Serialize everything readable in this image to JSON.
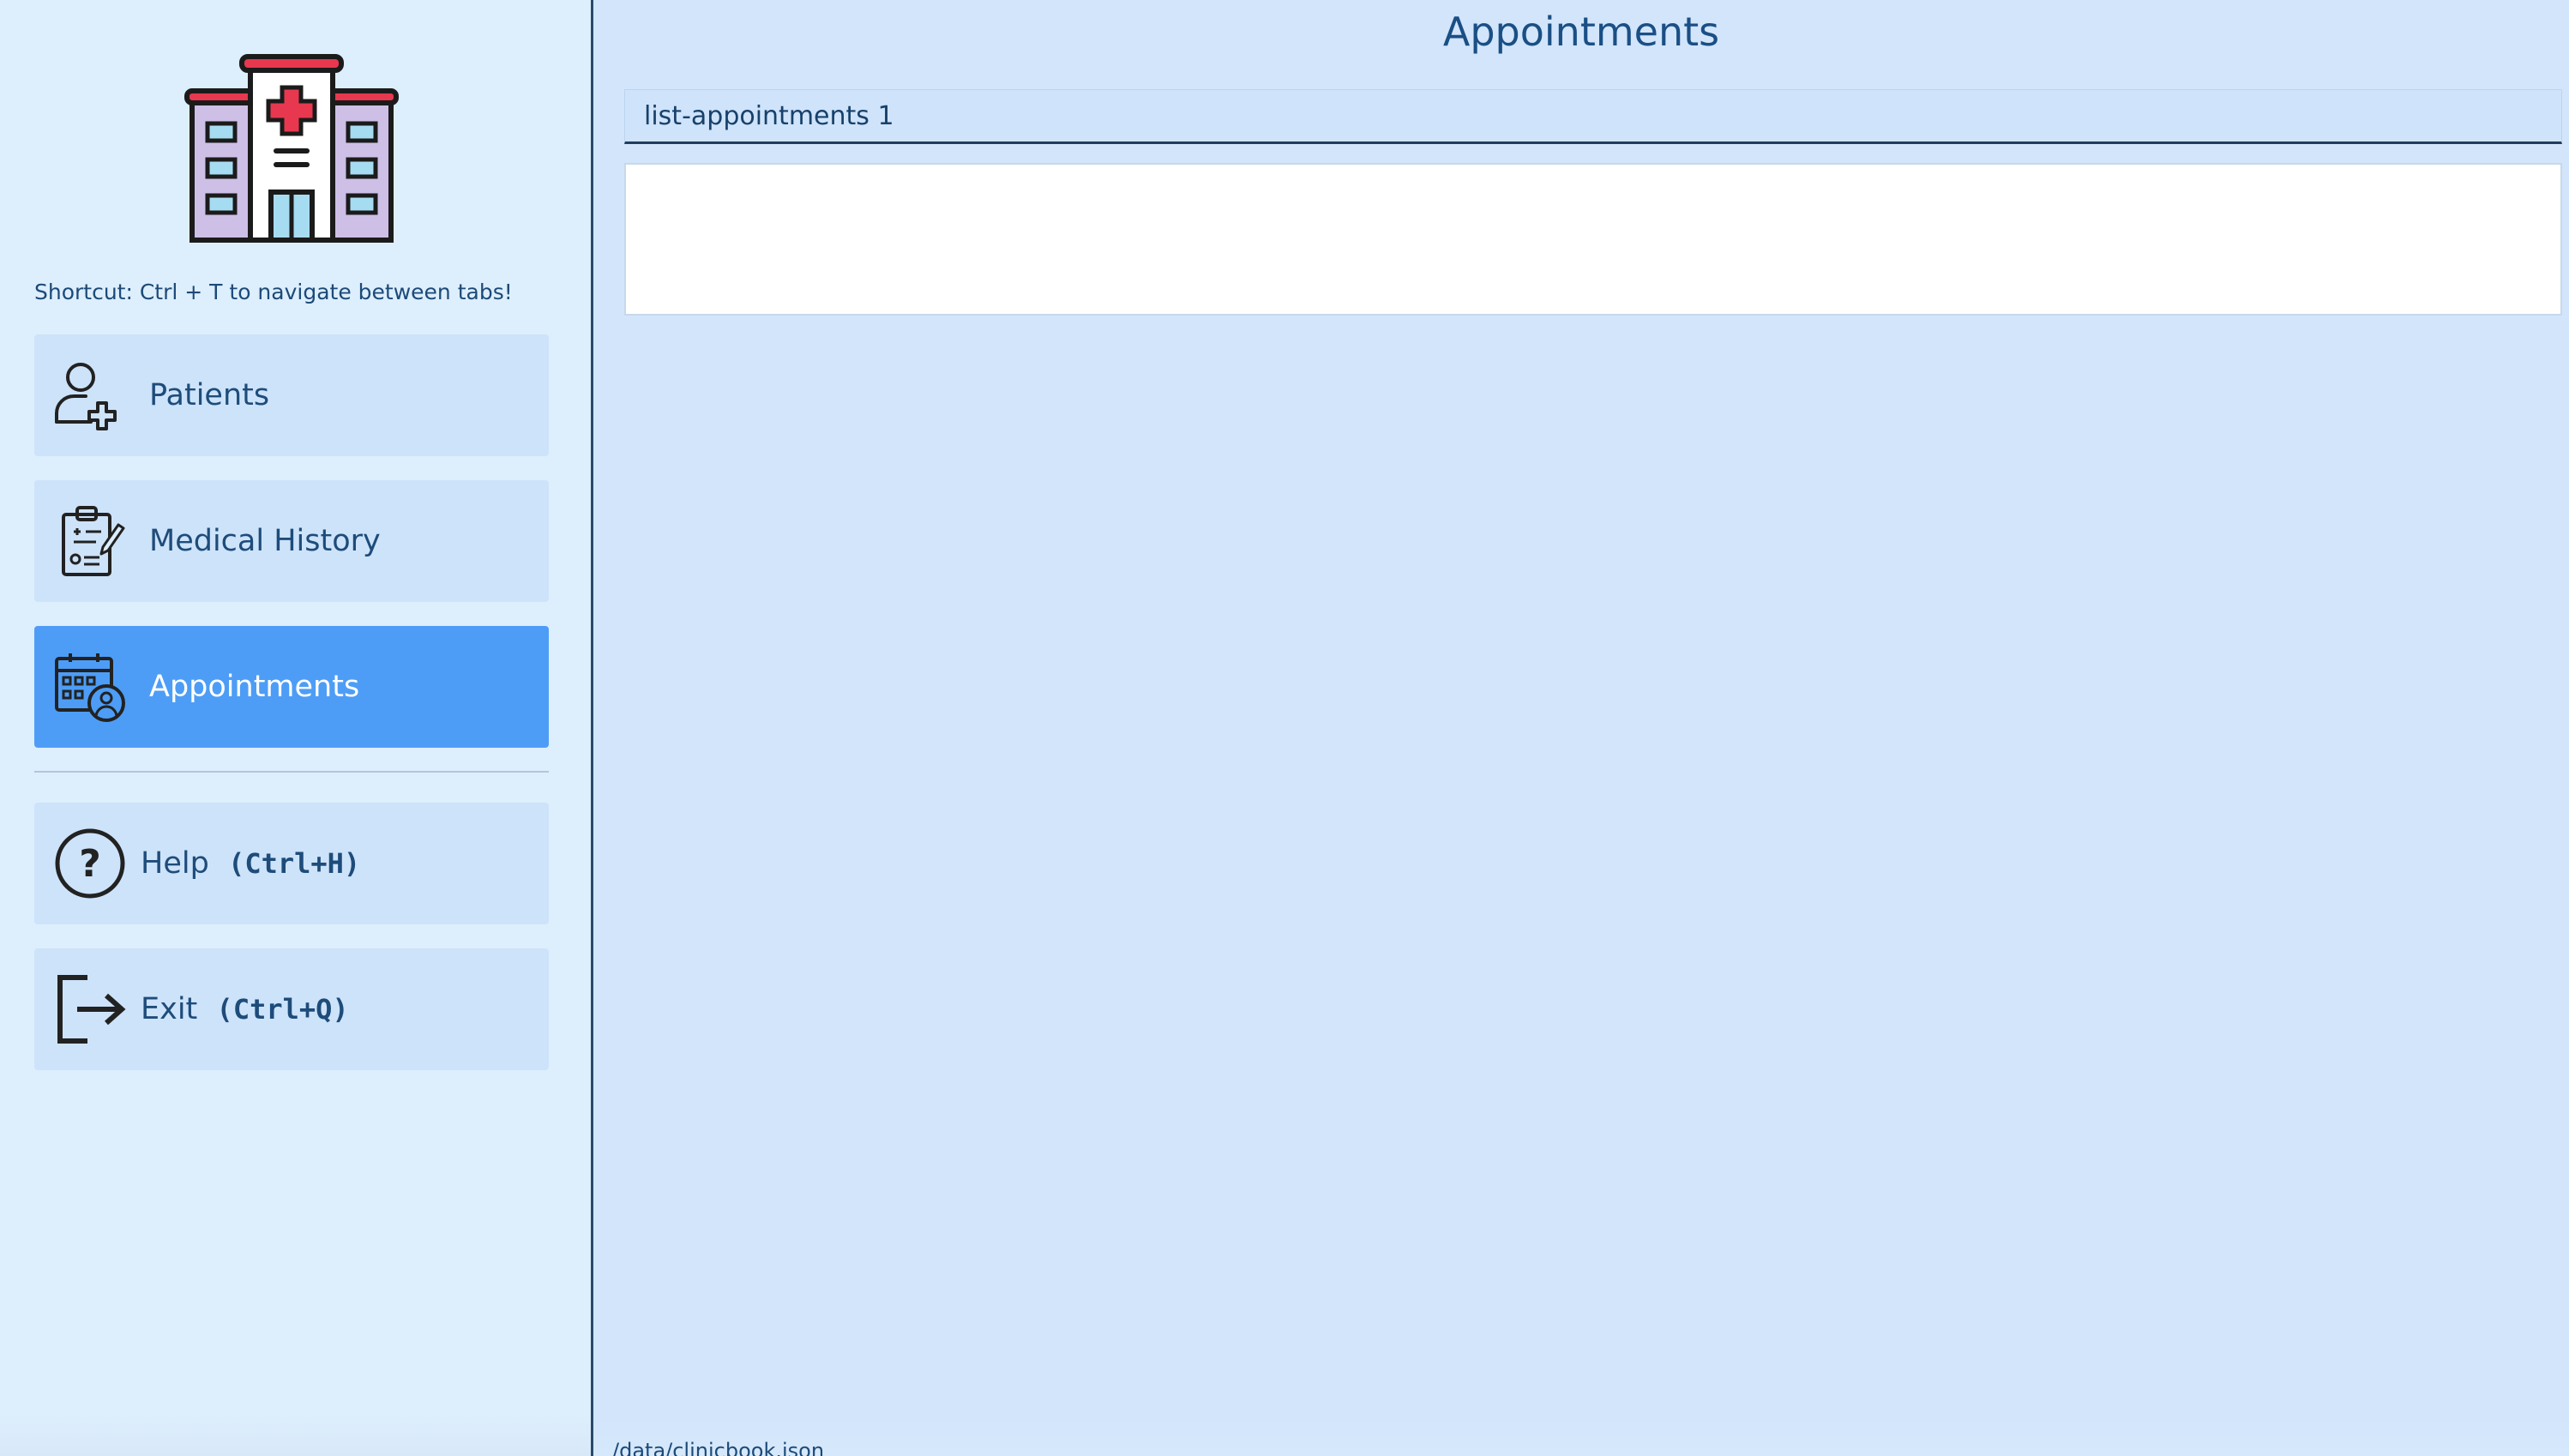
{
  "sidebar": {
    "logo_icon": "hospital-icon",
    "shortcut_text": "Shortcut: Ctrl + T to navigate between tabs!",
    "nav": [
      {
        "label": "Patients",
        "icon": "add-user-icon",
        "active": false
      },
      {
        "label": "Medical History",
        "icon": "clipboard-icon",
        "active": false
      },
      {
        "label": "Appointments",
        "icon": "calendar-doctor-icon",
        "active": true
      }
    ],
    "help": {
      "label": "Help",
      "shortcut": "(Ctrl+H)",
      "icon": "question-circle-icon"
    },
    "exit": {
      "label": "Exit",
      "shortcut": "(Ctrl+Q)",
      "icon": "exit-icon"
    }
  },
  "main": {
    "title": "Appointments",
    "command_value": "list-appointments 1",
    "result_text": "",
    "status_path": "/data/clinicbook.json"
  },
  "colors": {
    "active_nav": "#4d9df6",
    "nav_bg": "#cde3fa",
    "sidebar_bg": "#ddeefd",
    "main_bg": "#d2e5fb",
    "text": "#1e4c7a",
    "logo_red": "#e8384f"
  }
}
